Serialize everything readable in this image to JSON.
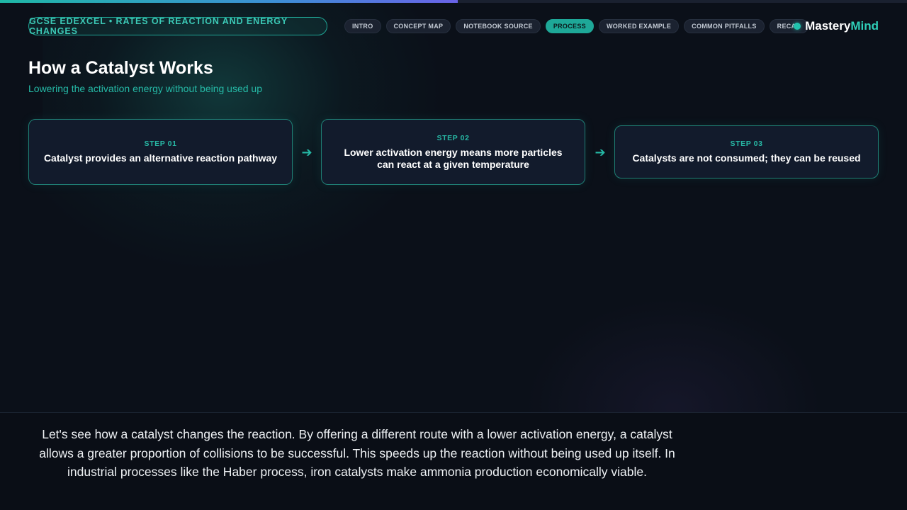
{
  "progress": {
    "fraction": 0.505
  },
  "header": {
    "course_label": "GCSE EDEXCEL • RATES OF REACTION AND ENERGY CHANGES",
    "tabs": [
      {
        "label": "INTRO",
        "active": false
      },
      {
        "label": "CONCEPT MAP",
        "active": false
      },
      {
        "label": "NOTEBOOK SOURCE",
        "active": false
      },
      {
        "label": "PROCESS",
        "active": true
      },
      {
        "label": "WORKED EXAMPLE",
        "active": false
      },
      {
        "label": "COMMON PITFALLS",
        "active": false
      },
      {
        "label": "RECAP",
        "active": false
      }
    ],
    "brand_part1": "Mastery",
    "brand_part2": "Mind"
  },
  "main": {
    "title": "How a Catalyst Works",
    "subtitle": "Lowering the activation energy without being used up",
    "steps": [
      {
        "label": "STEP 01",
        "text": "Catalyst provides an alternative reaction pathway"
      },
      {
        "label": "STEP 02",
        "text": "Lower activation energy means more particles can react at a given temperature"
      },
      {
        "label": "STEP 03",
        "text": "Catalysts are not consumed; they can be reused"
      }
    ],
    "arrow_glyph": "➔"
  },
  "caption": {
    "text": "Let's see how a catalyst changes the reaction. By offering a different route with a lower activation energy, a catalyst allows a greater proportion of collisions to be successful. This speeds up the reaction without being used up itself. In industrial processes like the Haber process, iron catalysts make ammonia production economically viable."
  },
  "colors": {
    "accent": "#1ea898",
    "background": "#0b1019",
    "card": "#121b2c"
  }
}
